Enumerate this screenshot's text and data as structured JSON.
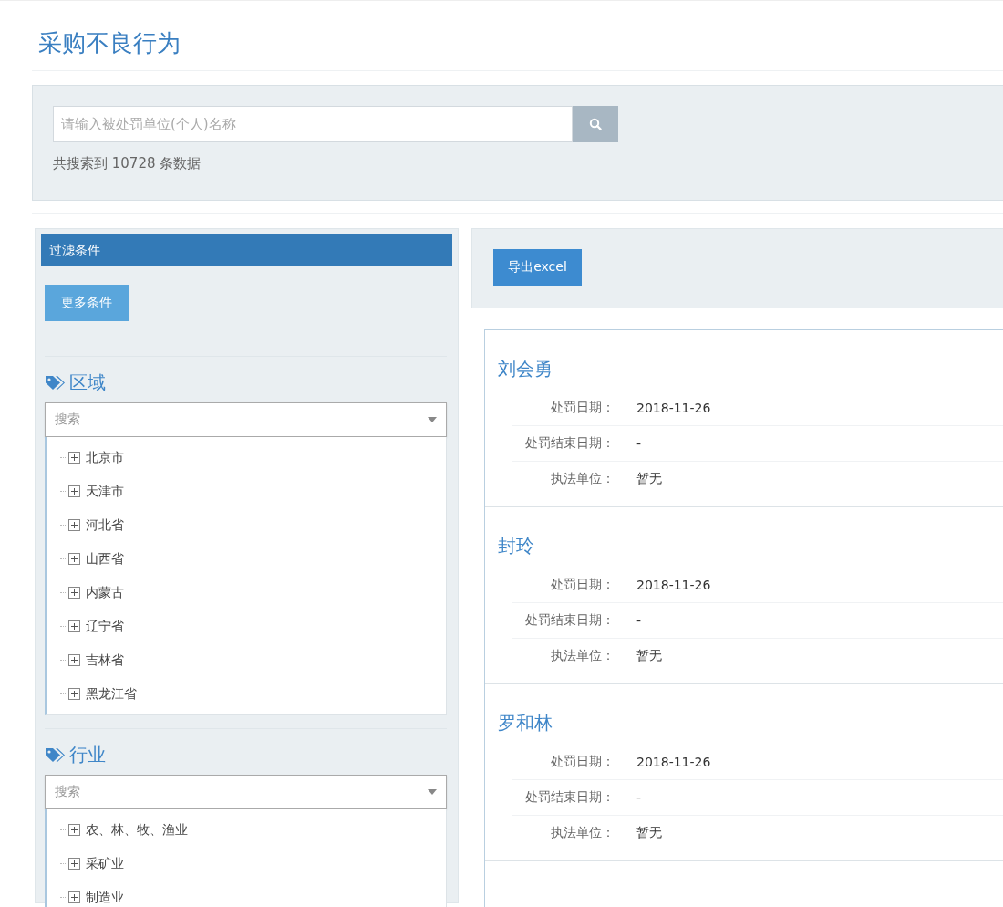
{
  "page": {
    "title": "采购不良行为"
  },
  "search": {
    "placeholder": "请输入被处罚单位(个人)名称",
    "result_count": "共搜索到 10728 条数据"
  },
  "filter": {
    "title": "过滤条件",
    "more_button": "更多条件",
    "sections": [
      {
        "title": "区域",
        "search_placeholder": "搜索",
        "items": [
          {
            "label": "北京市",
            "expanded": false
          },
          {
            "label": "天津市",
            "expanded": false
          },
          {
            "label": "河北省",
            "expanded": false
          },
          {
            "label": "山西省",
            "expanded": false
          },
          {
            "label": "内蒙古",
            "expanded": false
          },
          {
            "label": "辽宁省",
            "expanded": false
          },
          {
            "label": "吉林省",
            "expanded": false
          },
          {
            "label": "黑龙江省",
            "expanded": false
          }
        ]
      },
      {
        "title": "行业",
        "search_placeholder": "搜索",
        "items": [
          {
            "label": "农、林、牧、渔业",
            "expanded": false
          },
          {
            "label": "采矿业",
            "expanded": false
          },
          {
            "label": "制造业",
            "expanded": false
          }
        ]
      }
    ]
  },
  "toolbar": {
    "export_button": "导出excel"
  },
  "results": [
    {
      "name": "刘会勇",
      "fields": [
        {
          "label": "处罚日期：",
          "value": "2018-11-26"
        },
        {
          "label": "处罚结束日期：",
          "value": "-"
        },
        {
          "label": "执法单位：",
          "value": "暂无"
        }
      ]
    },
    {
      "name": "封玲",
      "fields": [
        {
          "label": "处罚日期：",
          "value": "2018-11-26"
        },
        {
          "label": "处罚结束日期：",
          "value": "-"
        },
        {
          "label": "执法单位：",
          "value": "暂无"
        }
      ]
    },
    {
      "name": "罗和林",
      "fields": [
        {
          "label": "处罚日期：",
          "value": "2018-11-26"
        },
        {
          "label": "处罚结束日期：",
          "value": "-"
        },
        {
          "label": "执法单位：",
          "value": "暂无"
        }
      ]
    }
  ]
}
